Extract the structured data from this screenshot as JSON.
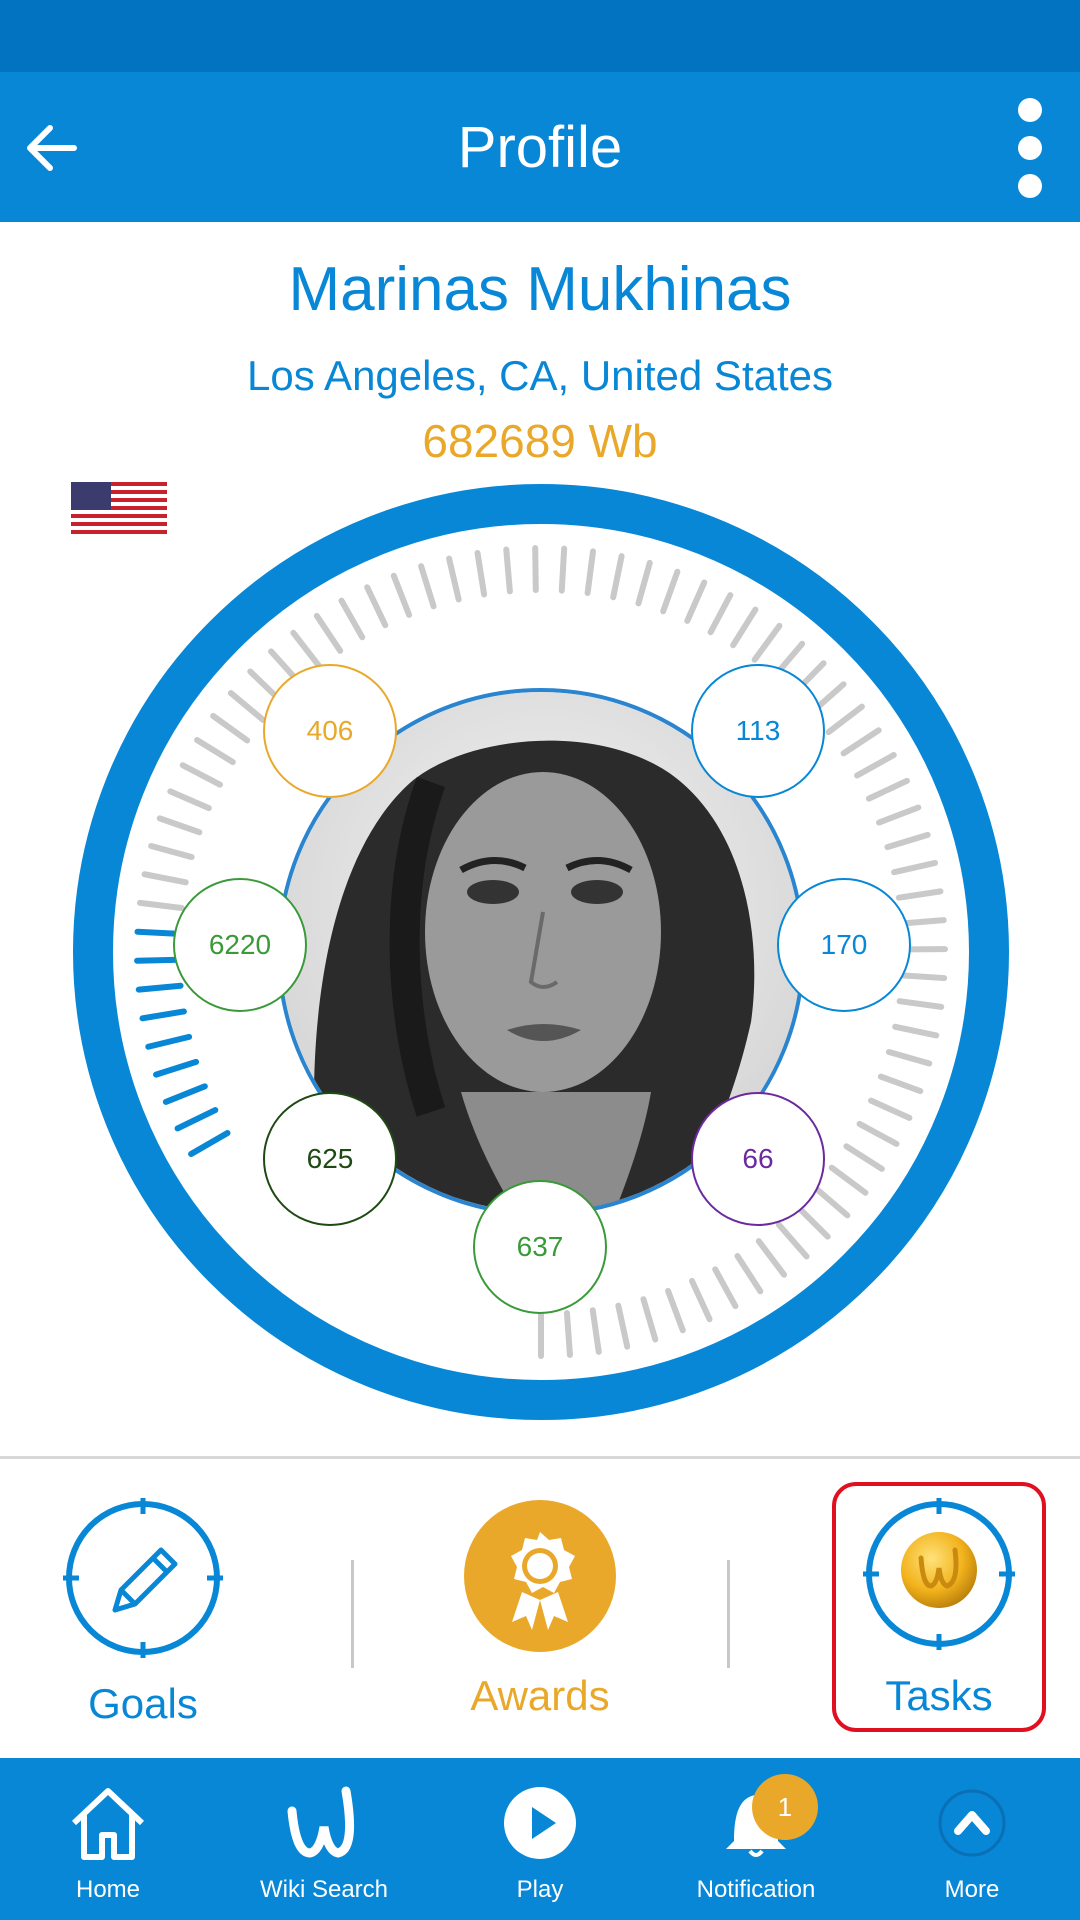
{
  "header": {
    "title": "Profile"
  },
  "profile": {
    "name": "Marinas Mukhinas",
    "location": "Los Angeles, CA, United States",
    "points": "682689 Wb"
  },
  "progress_fraction": 0.12,
  "badges": [
    {
      "value": "406",
      "color": "#eaa82a"
    },
    {
      "value": "113",
      "color": "#0787d6"
    },
    {
      "value": "6220",
      "color": "#3a9a3a"
    },
    {
      "value": "170",
      "color": "#0787d6"
    },
    {
      "value": "625",
      "color": "#1f4a14"
    },
    {
      "value": "66",
      "color": "#6b2aa0"
    },
    {
      "value": "637",
      "color": "#3a9a3a"
    }
  ],
  "actions": {
    "goals": "Goals",
    "awards": "Awards",
    "tasks": "Tasks"
  },
  "nav": {
    "home": "Home",
    "wiki_search": "Wiki Search",
    "play": "Play",
    "notification": "Notification",
    "notification_count": "1",
    "more": "More"
  },
  "colors": {
    "primary": "#0787d6",
    "status_bar": "#0173c0",
    "gold": "#eaa82a",
    "highlight": "#e01020"
  }
}
